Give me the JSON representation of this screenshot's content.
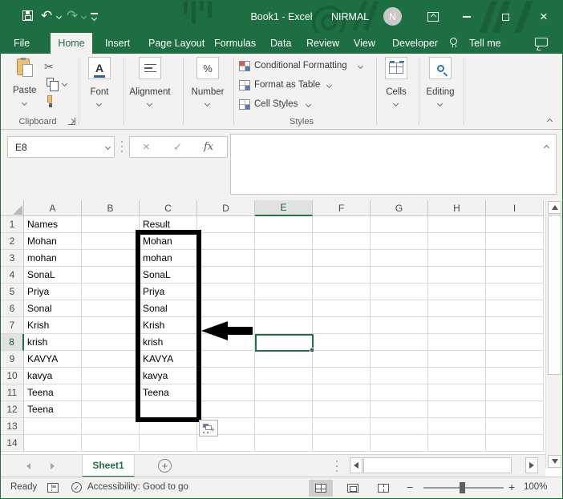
{
  "colors": {
    "excel_green": "#1d6f42",
    "tab_accent": "#217346",
    "selection_green": "#1f7246",
    "annotation": "#000000"
  },
  "title_bar": {
    "title": "Book1 - Excel",
    "user": "NIRMAL",
    "avatar_initial": "N"
  },
  "tabs": {
    "items": [
      "File",
      "Home",
      "Insert",
      "Page Layout",
      "Formulas",
      "Data",
      "Review",
      "View",
      "Developer"
    ],
    "active": "Home",
    "tell_me": "Tell me"
  },
  "ribbon": {
    "paste": "Paste",
    "clipboard_group": "Clipboard",
    "font_group": "Font",
    "font_glyph": "A",
    "alignment_group": "Alignment",
    "number_group": "Number",
    "number_glyph": "%",
    "styles_buttons": [
      "Conditional Formatting",
      "Format as Table",
      "Cell Styles"
    ],
    "styles_group": "Styles",
    "cells_group": "Cells",
    "editing_group": "Editing"
  },
  "formula_bar": {
    "name_box": "E8",
    "fx_label": "fx",
    "cancel_glyph": "×",
    "enter_glyph": "✓",
    "value": ""
  },
  "grid": {
    "columns": [
      "A",
      "B",
      "C",
      "D",
      "E",
      "F",
      "G",
      "H",
      "I"
    ],
    "row_count": 14,
    "selected_cell": "E8",
    "selected_column": "E",
    "selected_row": 8,
    "rows": [
      {
        "n": 1,
        "A": "Names",
        "C": "Result"
      },
      {
        "n": 2,
        "A": "Mohan",
        "C": "Mohan"
      },
      {
        "n": 3,
        "A": "mohan",
        "C": "mohan"
      },
      {
        "n": 4,
        "A": "SonaL",
        "C": "SonaL"
      },
      {
        "n": 5,
        "A": "Priya",
        "C": "Priya"
      },
      {
        "n": 6,
        "A": "Sonal",
        "C": "Sonal"
      },
      {
        "n": 7,
        "A": "Krish",
        "C": "Krish"
      },
      {
        "n": 8,
        "A": "krish",
        "C": "krish"
      },
      {
        "n": 9,
        "A": "KAVYA",
        "C": "KAVYA"
      },
      {
        "n": 10,
        "A": "kavya",
        "C": "kavya"
      },
      {
        "n": 11,
        "A": "Teena",
        "C": "Teena"
      },
      {
        "n": 12,
        "A": "Teena"
      },
      {
        "n": 13
      },
      {
        "n": 14
      }
    ]
  },
  "sheet_tabs": {
    "active": "Sheet1",
    "add_glyph": "+"
  },
  "status_bar": {
    "mode": "Ready",
    "accessibility": "Accessibility: Good to go",
    "zoom_level": "100%",
    "zoom_out": "−",
    "zoom_in": "+"
  }
}
